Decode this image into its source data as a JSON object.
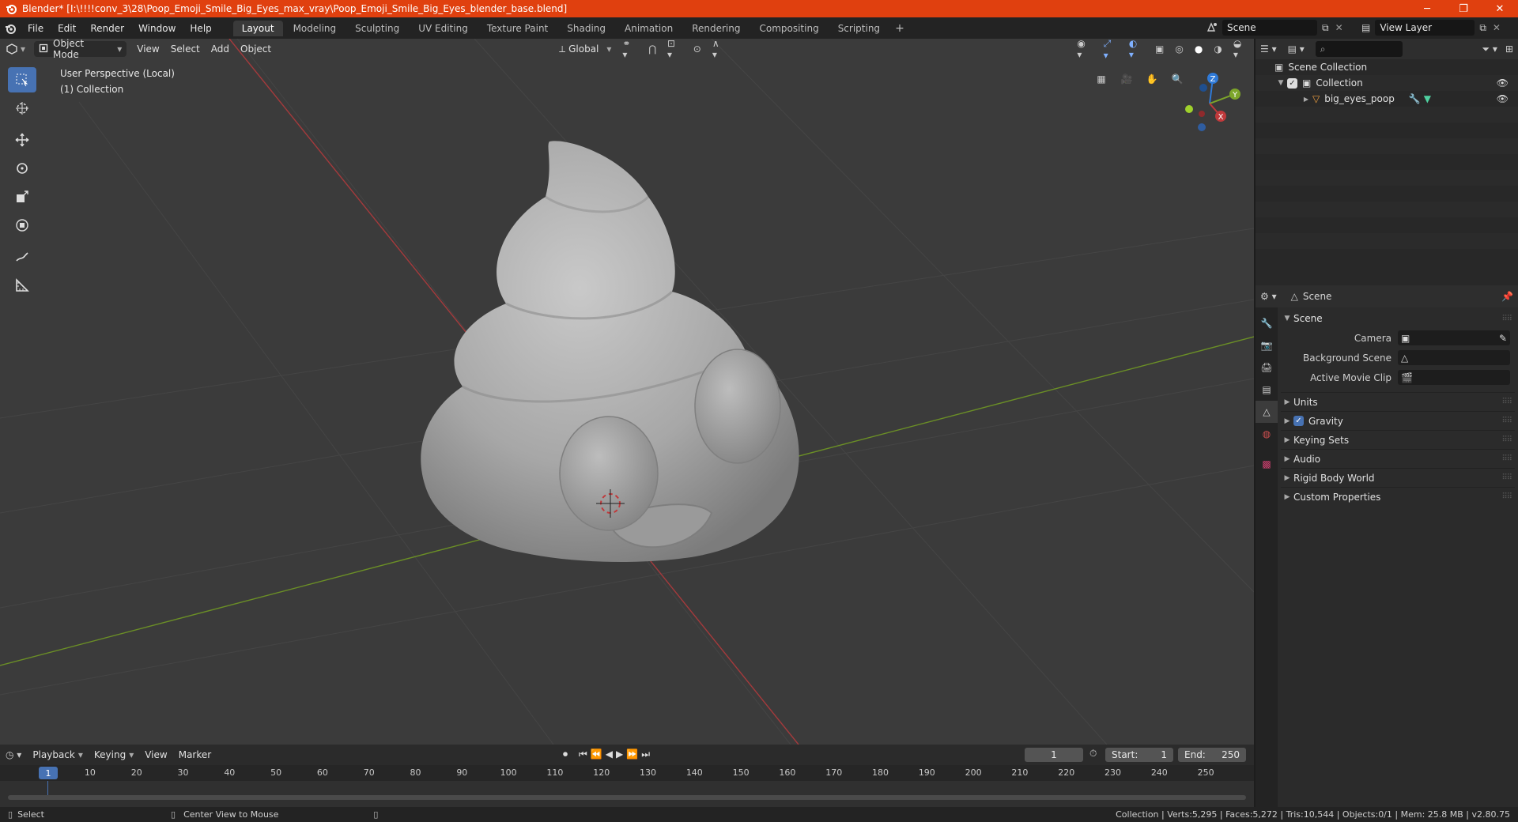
{
  "window": {
    "title": "Blender* [I:\\!!!!conv_3\\28\\Poop_Emoji_Smile_Big_Eyes_max_vray\\Poop_Emoji_Smile_Big_Eyes_blender_base.blend]",
    "minimize": "─",
    "maximize": "❐",
    "close": "✕"
  },
  "menu": {
    "items": [
      "File",
      "Edit",
      "Render",
      "Window",
      "Help"
    ]
  },
  "workspaces": {
    "tabs": [
      "Layout",
      "Modeling",
      "Sculpting",
      "UV Editing",
      "Texture Paint",
      "Shading",
      "Animation",
      "Rendering",
      "Compositing",
      "Scripting"
    ],
    "active": "Layout",
    "add": "+"
  },
  "scene_selector": {
    "value": "Scene"
  },
  "view_layer_selector": {
    "value": "View Layer"
  },
  "viewport": {
    "mode": "Object Mode",
    "menus": [
      "View",
      "Select",
      "Add",
      "Object"
    ],
    "transform_orientation": "Global",
    "perspective_label": "User Perspective (Local)",
    "collection_label": "(1) Collection",
    "gizmo_axes": {
      "x": "X",
      "y": "Y",
      "z": "Z"
    }
  },
  "outliner": {
    "rows": {
      "root": "Scene Collection",
      "collection": "Collection",
      "object": "big_eyes_poop"
    }
  },
  "properties": {
    "context": "Scene",
    "panel_title": "Scene",
    "fields": {
      "camera": "Camera",
      "background_scene": "Background Scene",
      "active_movie_clip": "Active Movie Clip"
    },
    "subpanels": [
      "Units",
      "Gravity",
      "Keying Sets",
      "Audio",
      "Rigid Body World",
      "Custom Properties"
    ],
    "gravity_enabled": true
  },
  "timeline": {
    "menus": [
      "Playback",
      "Keying",
      "View",
      "Marker"
    ],
    "current_frame": "1",
    "start_label": "Start:",
    "start": "1",
    "end_label": "End:",
    "end": "250",
    "ruler_ticks": [
      "10",
      "20",
      "30",
      "40",
      "50",
      "60",
      "70",
      "80",
      "90",
      "100",
      "110",
      "120",
      "130",
      "140",
      "150",
      "160",
      "170",
      "180",
      "190",
      "200",
      "210",
      "220",
      "230",
      "240",
      "250"
    ],
    "ruler_current": "1"
  },
  "statusbar": {
    "left_action": "Select",
    "middle_action": "Center View to Mouse",
    "stats": "Collection | Verts:5,295 | Faces:5,272 | Tris:10,544 | Objects:0/1 | Mem: 25.8 MB | v2.80.75"
  },
  "colors": {
    "title_bar": "#e0400f",
    "accent": "#4772b3",
    "viewport_bg": "#3b3b3b",
    "x_axis": "#c0393b",
    "y_axis": "#7da52a",
    "z_axis": "#2f7ad8"
  }
}
